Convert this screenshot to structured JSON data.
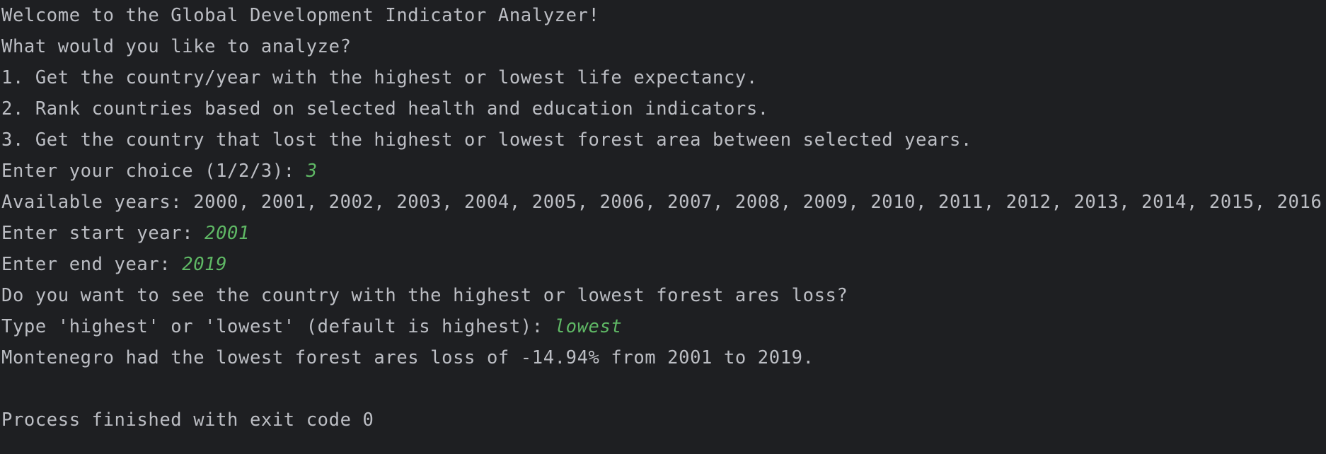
{
  "console": {
    "lines": {
      "welcome": "Welcome to the Global Development Indicator Analyzer!",
      "question": "What would you like to analyze?",
      "option1": "1. Get the country/year with the highest or lowest life expectancy.",
      "option2": "2. Rank countries based on selected health and education indicators.",
      "option3": "3. Get the country that lost the highest or lowest forest area between selected years.",
      "choice_prompt": "Enter your choice (1/2/3): ",
      "choice_input": "3",
      "available_years": "Available years: 2000, 2001, 2002, 2003, 2004, 2005, 2006, 2007, 2008, 2009, 2010, 2011, 2012, 2013, 2014, 2015, 2016",
      "start_prompt": "Enter start year: ",
      "start_input": "2001",
      "end_prompt": "Enter end year: ",
      "end_input": "2019",
      "mode_question": "Do you want to see the country with the highest or lowest forest ares loss?",
      "mode_prompt": "Type 'highest' or 'lowest' (default is highest): ",
      "mode_input": "lowest",
      "result": "Montenegro had the lowest forest ares loss of -14.94% from 2001 to 2019.",
      "exit": "Process finished with exit code 0"
    }
  },
  "colors": {
    "background": "#1e1f22",
    "text": "#bcbec4",
    "user_input": "#5fb865"
  }
}
